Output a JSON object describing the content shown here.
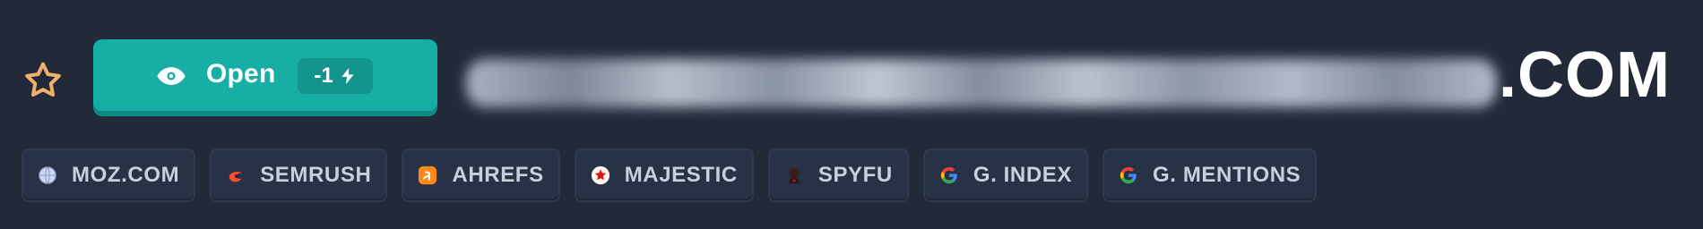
{
  "colors": {
    "background": "#222a3a",
    "accent": "#17aea5",
    "accent_shadow": "#0f8a84",
    "chip_bg": "#283247",
    "chip_text": "#c7d0dd",
    "star": "#f3b06a"
  },
  "icons": {
    "star": "star-icon",
    "eye": "eye-icon",
    "bolt": "bolt-icon"
  },
  "open_button": {
    "label": "Open",
    "cost": "-1"
  },
  "domain": {
    "tld": ".COM"
  },
  "chips": [
    {
      "label": "MOZ.COM",
      "icon": "globe-icon"
    },
    {
      "label": "SEMRUSH",
      "icon": "semrush-flame-icon"
    },
    {
      "label": "AHREFS",
      "icon": "ahrefs-a-icon"
    },
    {
      "label": "MAJESTIC",
      "icon": "majestic-star-icon"
    },
    {
      "label": "SPYFU",
      "icon": "spyfu-agent-icon"
    },
    {
      "label": "G. INDEX",
      "icon": "google-g-icon"
    },
    {
      "label": "G. MENTIONS",
      "icon": "google-g-icon"
    }
  ]
}
